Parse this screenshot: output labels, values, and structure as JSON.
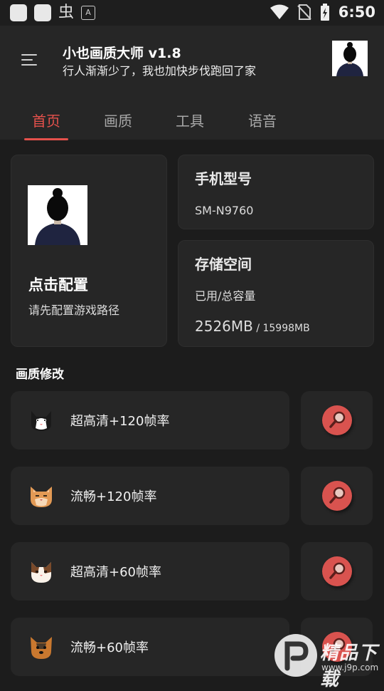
{
  "status_bar": {
    "time": "6:50",
    "left_glyph": "虫",
    "left_badge": "A",
    "icons": [
      "app-square-icon",
      "app-square-icon",
      "bug-icon",
      "a-badge-icon",
      "wifi-icon",
      "no-sim-icon",
      "battery-charging-icon"
    ]
  },
  "header": {
    "title": "小也画质大师 v1.8",
    "subtitle": "行人渐渐少了，我也加快步伐跑回了家"
  },
  "tabs": [
    {
      "label": "首页",
      "active": true
    },
    {
      "label": "画质",
      "active": false
    },
    {
      "label": "工具",
      "active": false
    },
    {
      "label": "语音",
      "active": false
    }
  ],
  "config_card": {
    "title": "点击配置",
    "subtitle": "请先配置游戏路径"
  },
  "model_card": {
    "title": "手机型号",
    "value": "SM-N9760"
  },
  "storage_card": {
    "title": "存储空间",
    "label": "已用/总容量",
    "used": "2526MB",
    "total": " / 15998MB"
  },
  "section": {
    "title": "画质修改"
  },
  "options": [
    {
      "label": "超高清+120帧率",
      "icon": "black-white-cat-icon"
    },
    {
      "label": "流畅+120帧率",
      "icon": "orange-cat-icon"
    },
    {
      "label": "超高清+60帧率",
      "icon": "calico-cat-icon"
    },
    {
      "label": "流畅+60帧率",
      "icon": "yorkie-dog-icon"
    }
  ],
  "watermark": {
    "text": "精品下载",
    "url": "www.j9p.com"
  },
  "colors": {
    "accent": "#e5514c",
    "background": "#1c1c1c",
    "card": "#262626"
  }
}
